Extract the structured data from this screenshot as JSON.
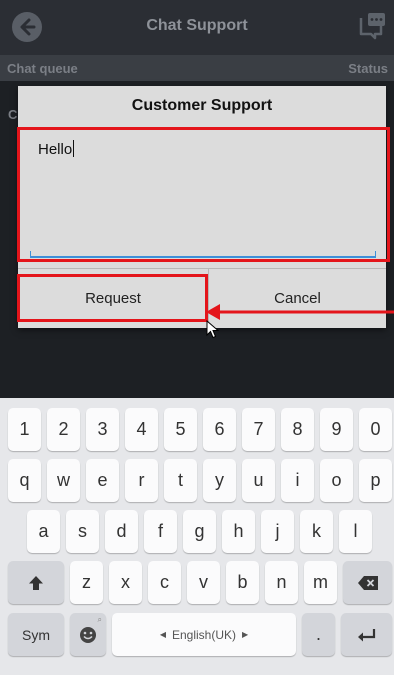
{
  "app": {
    "title": "Chat Support",
    "subheader_left": "Chat queue",
    "subheader_right": "Status",
    "peek_letter": "C"
  },
  "dialog": {
    "title": "Customer Support",
    "message_value": "Hello",
    "request_label": "Request",
    "cancel_label": "Cancel"
  },
  "annotation": {
    "color": "#e4151b"
  },
  "keyboard": {
    "row_numbers": [
      "1",
      "2",
      "3",
      "4",
      "5",
      "6",
      "7",
      "8",
      "9",
      "0"
    ],
    "row_q": [
      "q",
      "w",
      "e",
      "r",
      "t",
      "y",
      "u",
      "i",
      "o",
      "p"
    ],
    "row_a": [
      "a",
      "s",
      "d",
      "f",
      "g",
      "h",
      "j",
      "k",
      "l"
    ],
    "row_z": [
      "z",
      "x",
      "c",
      "v",
      "b",
      "n",
      "m"
    ],
    "sym_label": "Sym",
    "language_label": "English(UK)",
    "period_label": ".",
    "icons": {
      "shift": "shift-icon",
      "backspace": "backspace-icon",
      "emoji": "emoji-icon",
      "enter": "enter-icon"
    }
  }
}
